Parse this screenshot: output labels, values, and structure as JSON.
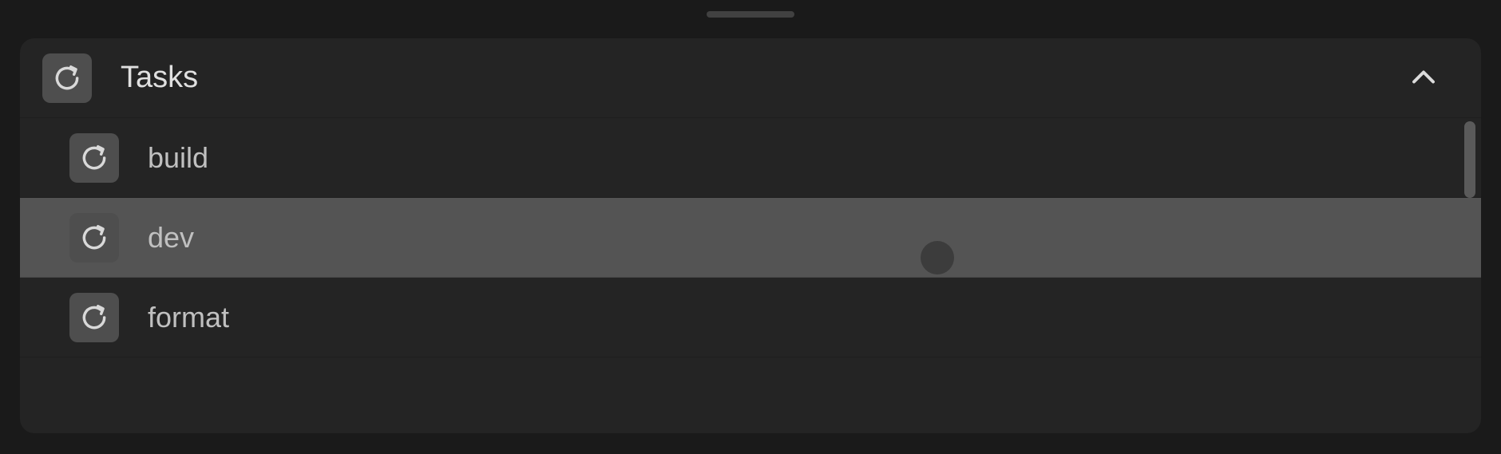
{
  "header": {
    "title": "Tasks",
    "collapsed": false
  },
  "tasks": [
    {
      "label": "build",
      "selected": false
    },
    {
      "label": "dev",
      "selected": true
    },
    {
      "label": "format",
      "selected": false
    }
  ]
}
